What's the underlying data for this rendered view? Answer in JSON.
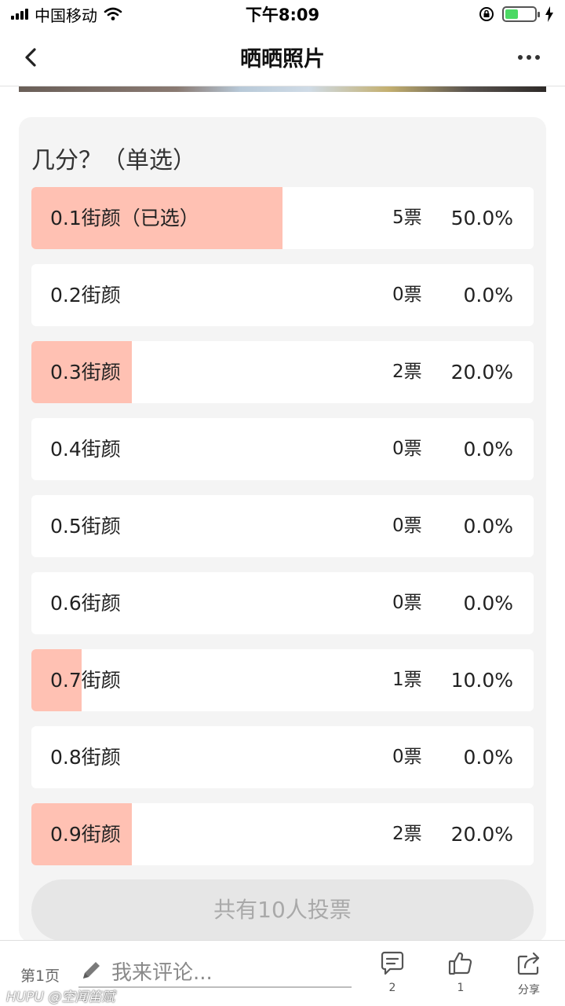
{
  "status_bar": {
    "carrier": "中国移动",
    "time": "下午8:09"
  },
  "nav": {
    "title": "晒晒照片"
  },
  "poll": {
    "question": "几分？（单选）",
    "options": [
      {
        "label": "0.1街颜（已选）",
        "votes": "5票",
        "percent": "50.0%",
        "fraction": 0.5,
        "selected": true
      },
      {
        "label": "0.2街颜",
        "votes": "0票",
        "percent": "0.0%",
        "fraction": 0.0,
        "selected": false
      },
      {
        "label": "0.3街颜",
        "votes": "2票",
        "percent": "20.0%",
        "fraction": 0.2,
        "selected": false
      },
      {
        "label": "0.4街颜",
        "votes": "0票",
        "percent": "0.0%",
        "fraction": 0.0,
        "selected": false
      },
      {
        "label": "0.5街颜",
        "votes": "0票",
        "percent": "0.0%",
        "fraction": 0.0,
        "selected": false
      },
      {
        "label": "0.6街颜",
        "votes": "0票",
        "percent": "0.0%",
        "fraction": 0.0,
        "selected": false
      },
      {
        "label": "0.7街颜",
        "votes": "1票",
        "percent": "10.0%",
        "fraction": 0.1,
        "selected": false
      },
      {
        "label": "0.8街颜",
        "votes": "0票",
        "percent": "0.0%",
        "fraction": 0.0,
        "selected": false
      },
      {
        "label": "0.9街颜",
        "votes": "2票",
        "percent": "20.0%",
        "fraction": 0.2,
        "selected": false
      }
    ],
    "total_label": "共有10人投票"
  },
  "bottom_bar": {
    "page_label": "第1页",
    "comment_placeholder": "我来评论...",
    "comments_count": "2",
    "likes_count": "1",
    "share_label": "分享"
  },
  "watermark": "HUPU @空闻笛赋",
  "colors": {
    "vote_bar": "#ffc1b3",
    "card_bg": "#f4f4f4",
    "battery": "#4cd964"
  },
  "icons": [
    "back-icon",
    "more-icon",
    "pencil-icon",
    "comment-icon",
    "thumbs-up-icon",
    "share-icon",
    "wifi-icon",
    "signal-icon",
    "battery-icon",
    "lock-rotation-icon",
    "charging-icon"
  ]
}
